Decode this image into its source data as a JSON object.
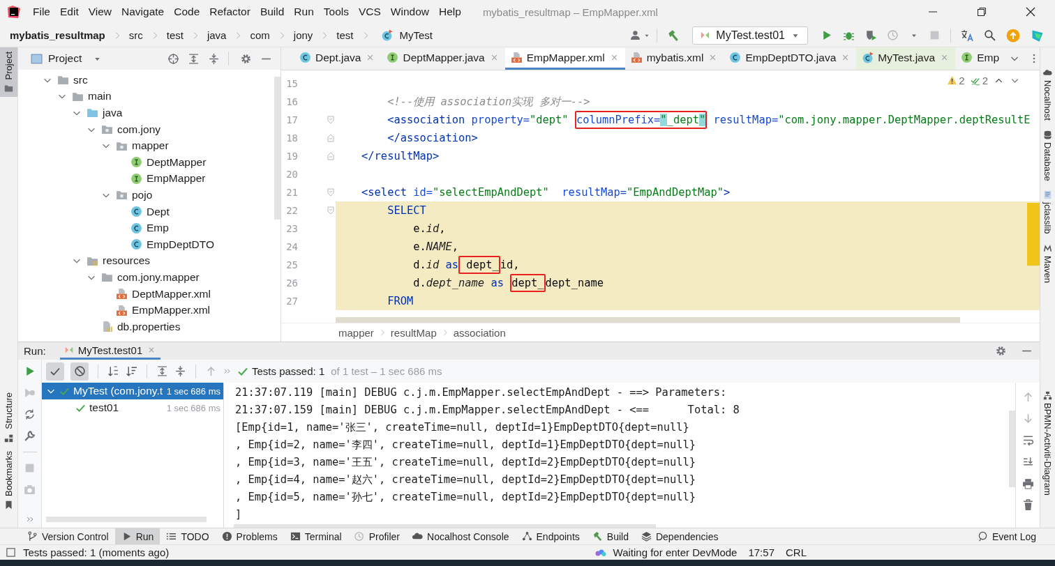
{
  "menu_bar": {
    "items": [
      "File",
      "Edit",
      "View",
      "Navigate",
      "Code",
      "Refactor",
      "Build",
      "Run",
      "Tools",
      "VCS",
      "Window",
      "Help"
    ],
    "title": "mybatis_resultmap – EmpMapper.xml"
  },
  "nav_bar": {
    "breadcrumbs": [
      {
        "label": "mybatis_resultmap",
        "kind": "project"
      },
      {
        "label": "src",
        "kind": "plain"
      },
      {
        "label": "test",
        "kind": "plain"
      },
      {
        "label": "java",
        "kind": "plain"
      },
      {
        "label": "com",
        "kind": "plain"
      },
      {
        "label": "jony",
        "kind": "plain"
      },
      {
        "label": "test",
        "kind": "plain"
      },
      {
        "label": "MyTest",
        "kind": "test-class"
      }
    ],
    "run_config": "MyTest.test01"
  },
  "left_stripe": [
    {
      "label": "Project",
      "selected": true
    },
    {
      "label": "Structure",
      "selected": false
    },
    {
      "label": "Bookmarks",
      "selected": false
    }
  ],
  "project": {
    "title": "Project",
    "tree": [
      {
        "label": "src",
        "kind": "folder",
        "expanded": true,
        "children": [
          {
            "label": "main",
            "kind": "folder",
            "expanded": true,
            "children": [
              {
                "label": "java",
                "kind": "source-folder",
                "expanded": true,
                "children": [
                  {
                    "label": "com.jony",
                    "kind": "package",
                    "expanded": true,
                    "children": [
                      {
                        "label": "mapper",
                        "kind": "package",
                        "expanded": true,
                        "children": [
                          {
                            "label": "DeptMapper",
                            "kind": "interface"
                          },
                          {
                            "label": "EmpMapper",
                            "kind": "interface"
                          }
                        ]
                      },
                      {
                        "label": "pojo",
                        "kind": "package",
                        "expanded": true,
                        "children": [
                          {
                            "label": "Dept",
                            "kind": "class"
                          },
                          {
                            "label": "Emp",
                            "kind": "class"
                          },
                          {
                            "label": "EmpDeptDTO",
                            "kind": "class"
                          }
                        ]
                      }
                    ]
                  }
                ]
              },
              {
                "label": "resources",
                "kind": "resources-folder",
                "expanded": true,
                "children": [
                  {
                    "label": "com.jony.mapper",
                    "kind": "folder",
                    "expanded": true,
                    "children": [
                      {
                        "label": "DeptMapper.xml",
                        "kind": "xml"
                      },
                      {
                        "label": "EmpMapper.xml",
                        "kind": "xml"
                      }
                    ]
                  },
                  {
                    "label": "db.properties",
                    "kind": "properties"
                  }
                ]
              }
            ]
          }
        ]
      }
    ]
  },
  "editor": {
    "tabs": [
      {
        "label": "Dept.java",
        "kind": "class",
        "selected": false
      },
      {
        "label": "DeptMapper.java",
        "kind": "interface",
        "selected": false
      },
      {
        "label": "EmpMapper.xml",
        "kind": "xml",
        "selected": true
      },
      {
        "label": "mybatis.xml",
        "kind": "xml",
        "selected": false
      },
      {
        "label": "EmpDeptDTO.java",
        "kind": "class",
        "selected": false
      },
      {
        "label": "MyTest.java",
        "kind": "test-class",
        "selected": false
      },
      {
        "label": "Emp",
        "kind": "interface",
        "selected": false
      }
    ],
    "warnings": "2",
    "checks": "2",
    "lines": [
      {
        "number": "15"
      },
      {
        "number": "16",
        "segments": [
          {
            "text": "        <!--使用 association实现 多对一-->",
            "kind": "comment"
          }
        ]
      },
      {
        "number": "17",
        "kind": "fold-start",
        "segments": [
          {
            "text": "        <association",
            "kind": "tag"
          },
          {
            "text": " property=",
            "kind": "attr"
          },
          {
            "text": "\"dept\" ",
            "kind": "value"
          },
          {
            "kind": "box",
            "parts": [
              {
                "text": "columnPrefix=",
                "kind": "attr"
              },
              {
                "text": "\"",
                "kind": "match"
              },
              {
                "text": "_dept",
                "kind": "value"
              },
              {
                "text": "\"",
                "kind": "match"
              }
            ]
          },
          {
            "text": " resultMap=",
            "kind": "attr"
          },
          {
            "text": "\"com.jony.mapper.DeptMapper.deptResultE",
            "kind": "value"
          }
        ]
      },
      {
        "number": "18",
        "kind": "fold-end",
        "segments": [
          {
            "text": "        </association>",
            "kind": "tag"
          }
        ]
      },
      {
        "number": "19",
        "kind": "fold-end",
        "segments": [
          {
            "text": "    </resultMap>",
            "kind": "tag"
          }
        ]
      },
      {
        "number": "20"
      },
      {
        "number": "21",
        "kind": "fold-start",
        "segments": [
          {
            "text": "    <select",
            "kind": "tag"
          },
          {
            "text": " id=",
            "kind": "attr"
          },
          {
            "text": "\"selectEmpAndDept\"",
            "kind": "value"
          },
          {
            "text": "  resultMap=",
            "kind": "attr"
          },
          {
            "text": "\"EmpAndDeptMap\"",
            "kind": "value"
          },
          {
            "text": ">",
            "kind": "tag"
          }
        ]
      },
      {
        "number": "22",
        "kind": "fold-start",
        "injected": true,
        "segments": [
          {
            "text": "        SELECT",
            "kind": "keyword"
          }
        ]
      },
      {
        "number": "23",
        "injected": true,
        "segments": [
          {
            "text": "            e.",
            "kind": "plain"
          },
          {
            "text": "id",
            "kind": "field"
          },
          {
            "text": ",",
            "kind": "plain"
          }
        ]
      },
      {
        "number": "24",
        "injected": true,
        "segments": [
          {
            "text": "            e.",
            "kind": "plain"
          },
          {
            "text": "NAME",
            "kind": "field"
          },
          {
            "text": ",",
            "kind": "plain"
          }
        ]
      },
      {
        "number": "25",
        "injected": true,
        "segments": [
          {
            "text": "            d.",
            "kind": "plain"
          },
          {
            "text": "id",
            "kind": "field"
          },
          {
            "text": " as",
            "kind": "keyword"
          },
          {
            "kind": "box",
            "parts": [
              {
                "text": " dept_",
                "kind": "plain"
              }
            ]
          },
          {
            "text": "id,",
            "kind": "plain"
          }
        ]
      },
      {
        "number": "26",
        "injected": true,
        "segments": [
          {
            "text": "            d.",
            "kind": "plain"
          },
          {
            "text": "dept_name",
            "kind": "field"
          },
          {
            "text": " as ",
            "kind": "keyword"
          },
          {
            "kind": "box",
            "parts": [
              {
                "text": "dept_",
                "kind": "plain"
              }
            ]
          },
          {
            "text": "dept_name",
            "kind": "plain"
          }
        ]
      },
      {
        "number": "27",
        "injected": true,
        "segments": [
          {
            "text": "        FROM",
            "kind": "keyword"
          }
        ]
      }
    ],
    "breadcrumbs": [
      "mapper",
      "resultMap",
      "association"
    ]
  },
  "right_stripe": [
    {
      "label": "Nocalhost"
    },
    {
      "label": "Database"
    },
    {
      "label": "jclasslib"
    },
    {
      "label": "Maven"
    },
    {
      "label": "BPMN-Activiti-Diagram"
    }
  ],
  "run": {
    "label": "Run:",
    "tabs": [
      {
        "label": "MyTest.test01",
        "selected": true
      }
    ],
    "show_passed": true,
    "show_ignored": true,
    "status": "Tests passed: 1",
    "status_detail": "of 1 test – 1 sec 686 ms",
    "tests": [
      {
        "label": "MyTest (com.jony.t",
        "time": "1 sec 686 ms",
        "selected": true,
        "expanded": true,
        "children": [
          {
            "label": "test01",
            "time": "1 sec 686 ms",
            "selected": false
          }
        ]
      }
    ],
    "console": [
      "21:37:07.119 [main] DEBUG c.j.m.EmpMapper.selectEmpAndDept - ==> Parameters:",
      "21:37:07.159 [main] DEBUG c.j.m.EmpMapper.selectEmpAndDept - <==      Total: 8",
      "[Emp{id=1, name='张三', createTime=null, deptId=1}EmpDeptDTO{dept=null}",
      ", Emp{id=2, name='李四', createTime=null, deptId=1}EmpDeptDTO{dept=null}",
      ", Emp{id=3, name='王五', createTime=null, deptId=2}EmpDeptDTO{dept=null}",
      ", Emp{id=4, name='赵六', createTime=null, deptId=2}EmpDeptDTO{dept=null}",
      ", Emp{id=5, name='孙七', createTime=null, deptId=2}EmpDeptDTO{dept=null}",
      "]"
    ]
  },
  "tool_tabs": [
    {
      "label": "Version Control",
      "kind": "branch",
      "selected": false
    },
    {
      "label": "Run",
      "kind": "run",
      "selected": true
    },
    {
      "label": "TODO",
      "kind": "list",
      "selected": false
    },
    {
      "label": "Problems",
      "kind": "alert",
      "selected": false
    },
    {
      "label": "Terminal",
      "kind": "terminal",
      "selected": false
    },
    {
      "label": "Profiler",
      "kind": "profiler",
      "selected": false
    },
    {
      "label": "Nocalhost Console",
      "kind": "cloud",
      "selected": false
    },
    {
      "label": "Endpoints",
      "kind": "endpoints",
      "selected": false
    },
    {
      "label": "Build",
      "kind": "hammer",
      "selected": false
    },
    {
      "label": "Dependencies",
      "kind": "layers",
      "selected": false
    },
    {
      "label": "Event Log",
      "kind": "bubble",
      "selected": false
    }
  ],
  "status_bar": {
    "message": "Tests passed: 1 (moments ago)",
    "devmode": "Waiting for enter DevMode",
    "position": "17:57",
    "line_separator": "CRL"
  }
}
